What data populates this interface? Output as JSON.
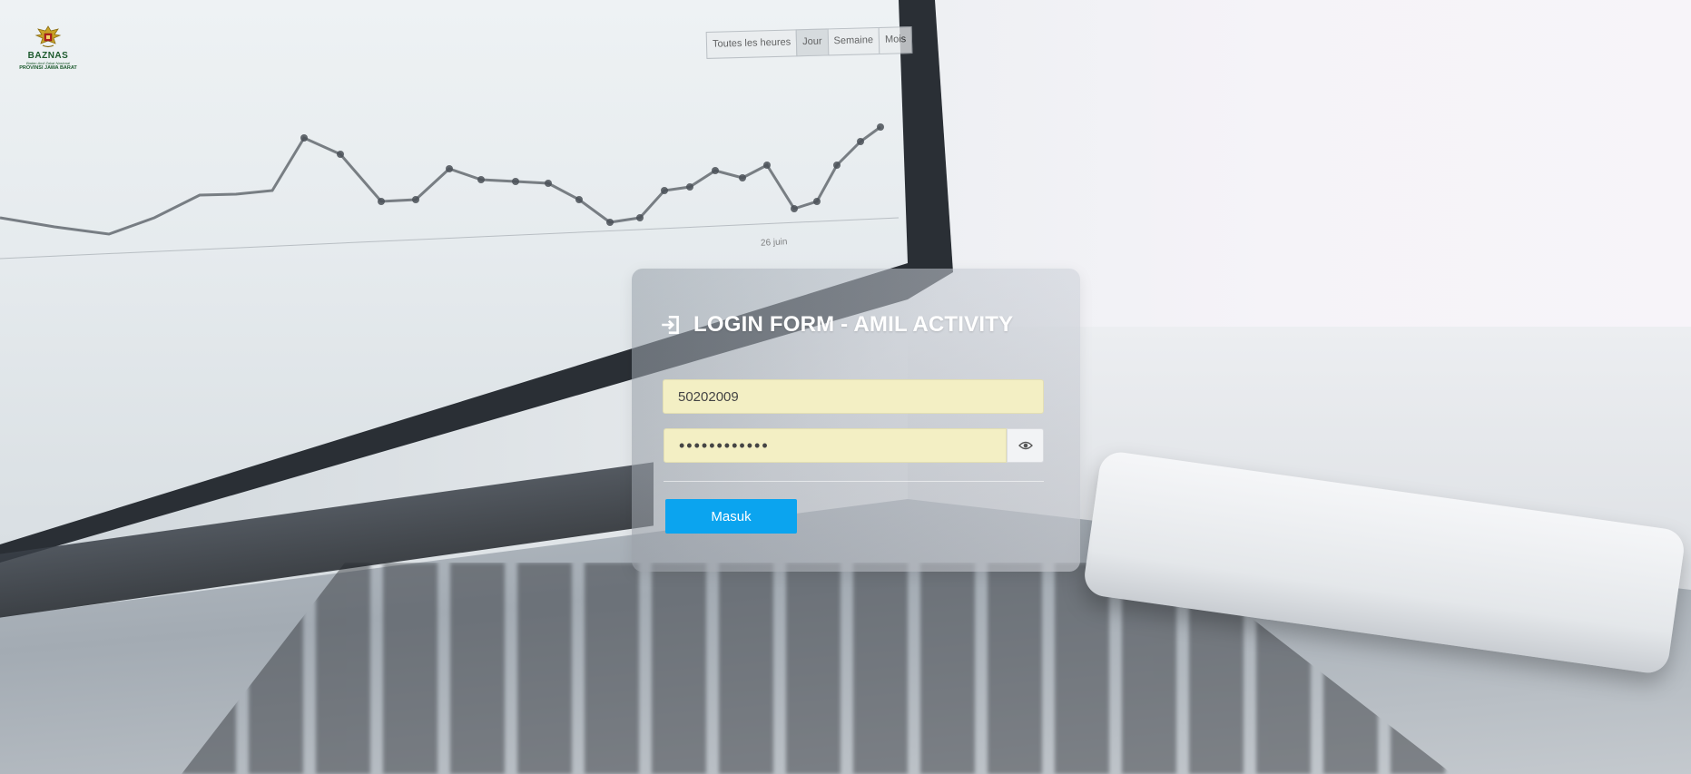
{
  "brand": {
    "name": "BAZNAS",
    "tagline": "Badan Amil Zakat Nasional",
    "region": "PROVINSI JAWA BARAT"
  },
  "background": {
    "timeframes": [
      "Toutes les heures",
      "Jour",
      "Semaine",
      "Mois"
    ],
    "active_timeframe": "Jour",
    "axis_labels": [
      "26 juin"
    ]
  },
  "login": {
    "title": "LOGIN FORM - AMIL ACTIVITY",
    "username_value": "50202009",
    "password_value": "••••••••••••",
    "submit_label": "Masuk"
  },
  "icons": {
    "title_icon": "login-icon",
    "password_toggle": "eye-icon",
    "logo": "garuda-emblem"
  },
  "colors": {
    "submit_button": "#0ba4ef",
    "input_autofill": "#f3efc4",
    "title_text": "#ffffff",
    "logo_green": "#1d5a2e"
  }
}
